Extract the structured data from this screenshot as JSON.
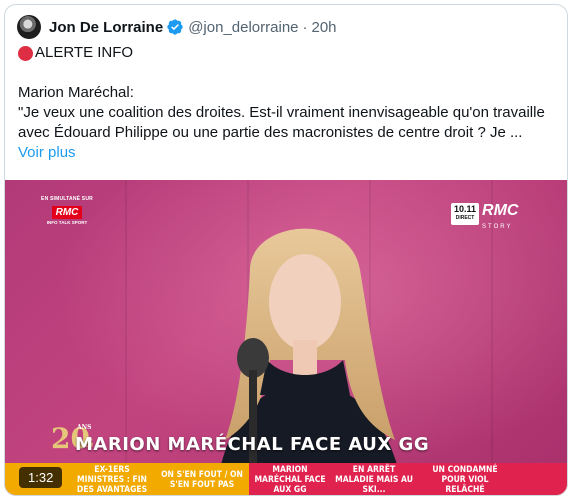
{
  "author": {
    "display_name": "Jon De Lorraine",
    "handle": "@jon_delorraine",
    "separator": "·",
    "time": "20h"
  },
  "tweet": {
    "alert_text": "ALERTE INFO",
    "line1": "Marion Maréchal:",
    "line2": "\"Je veux une coalition des droites. Est-il vraiment inenvisageable qu'on travaille",
    "line3": "avec Édouard Philippe ou une partie des macronistes de centre droit ? Je ...",
    "show_more": "Voir plus"
  },
  "video": {
    "timer": "1:32",
    "rmc_left_top": "EN SIMULTANÉ SUR",
    "rmc_left_badge": "RMC",
    "rmc_left_bottom": "INFO TALK SPORT",
    "rmc_right_box": "10.11",
    "rmc_right_box_sub": "DIRECT",
    "rmc_right_brand": "RMC",
    "rmc_right_brand_sub": "STORY",
    "logo_number": "20",
    "logo_ans": "ANS",
    "logo_gg": "GG",
    "lower_third": "MARION MARÉCHAL FACE AUX GG",
    "ticker": [
      "EX-1ERS MINISTRES : FIN DES AVANTAGES",
      "ON S'EN FOUT / ON S'EN FOUT PAS",
      "MARION MARÉCHAL FACE AUX GG",
      "EN ARRÊT MALADIE MAIS AU SKI...",
      "UN CONDAMNÉ POUR VIOL RELÂCHÉ"
    ]
  },
  "colors": {
    "accent": "#1d9bf0",
    "alert_red": "#dd2e44",
    "ticker_orange": "#f2a900",
    "ticker_pink": "#e0224e"
  }
}
